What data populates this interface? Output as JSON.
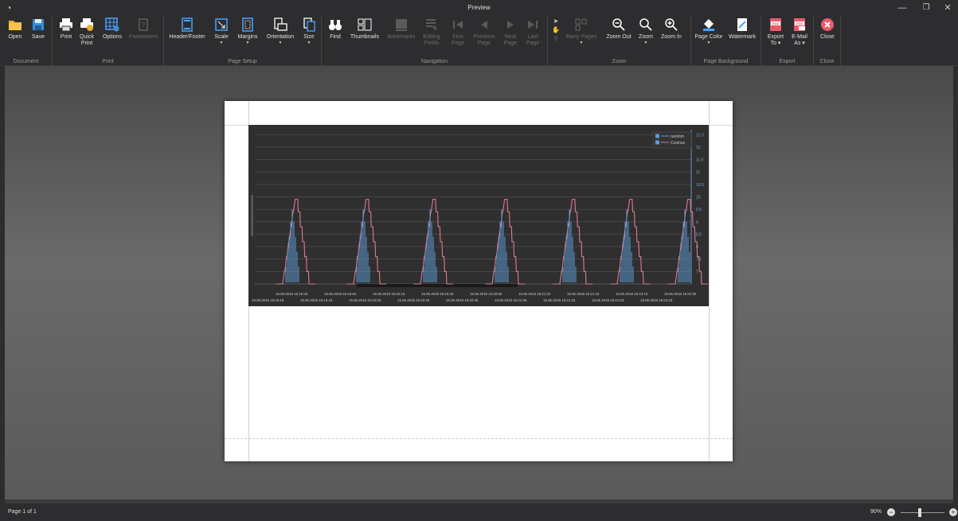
{
  "window": {
    "title": "Preview",
    "minimize": "—",
    "maximize": "❐",
    "close": "✕"
  },
  "ribbon": {
    "document": {
      "label": "Document",
      "open": "Open",
      "save": "Save"
    },
    "print": {
      "label": "Print",
      "print": "Print",
      "quick_print_1": "Quick",
      "quick_print_2": "Print",
      "options": "Options",
      "parameters": "Parameters"
    },
    "page_setup": {
      "label": "Page Setup",
      "header_footer": "Header/Footer",
      "scale": "Scale",
      "margins": "Margins",
      "orientation": "Orientation",
      "size": "Size"
    },
    "navigation": {
      "label": "Navigation",
      "find": "Find",
      "thumbnails": "Thumbnails",
      "bookmarks": "Bookmarks",
      "editing_1": "Editing",
      "editing_2": "Fields",
      "first_1": "First",
      "first_2": "Page",
      "previous_1": "Previous",
      "previous_2": "Page",
      "next_1": "Next",
      "next_2": "Page",
      "last_1": "Last",
      "last_2": "Page"
    },
    "zoom": {
      "label": "Zoom",
      "many_pages": "Many Pages",
      "zoom_out": "Zoom Out",
      "zoom": "Zoom",
      "zoom_in": "Zoom In"
    },
    "page_background": {
      "label": "Page Background",
      "page_color": "Page Color",
      "watermark": "Watermark"
    },
    "export": {
      "label": "Export",
      "export_1": "Export",
      "export_2": "To ▾",
      "email_1": "E-Mail",
      "email_2": "As ▾"
    },
    "close": {
      "label": "Close",
      "close": "Close"
    }
  },
  "statusbar": {
    "page": "Page 1 of 1",
    "zoom": "90%"
  },
  "colors": {
    "random": "#5b9bd5",
    "cosinus": "#e07a8f",
    "chart_bg": "#2f2f2f",
    "grid": "#555555"
  },
  "chart_data": {
    "type": "line",
    "legend": [
      "random",
      "Cosinus"
    ],
    "legend_position": "top-right",
    "y_ticks": [
      "12.5",
      "12",
      "11.5",
      "11",
      "10.5",
      "10",
      "9.5",
      "9",
      "8.5",
      "8",
      "7.5",
      "7"
    ],
    "ylim": [
      6.5,
      12.7
    ],
    "x_ticks_row1": [
      "15.06.2018 16:19:33",
      "15.06.2018 16:19:53",
      "15.06.2018 16:20:15",
      "15.06.2018 16:20:35",
      "15.06.2018 16:20:55",
      "15.06.2018 16:21:23",
      "15.06.2018 16:21:43",
      "15.06.2018 16:22:10",
      "15.06.2018 16:22:30"
    ],
    "x_ticks_row2": [
      "15.06.2018 16:19:18",
      "15.06.2018 16:19:43",
      "15.06.2018 16:20:03",
      "15.06.2018 16:20:25",
      "15.06.2018 16:20:45",
      "15.06.2018 16:21:08",
      "15.06.2018 16:21:33",
      "15.06.2018 16:21:53",
      "15.06.2018 16:22:20"
    ],
    "series": [
      {
        "name": "Cosinus",
        "peaks": 7,
        "peak_value": 9.9,
        "base_value": 6.5
      },
      {
        "name": "random",
        "peaks": 7,
        "peak_value": 9.5,
        "base_value": 6.5
      }
    ]
  }
}
